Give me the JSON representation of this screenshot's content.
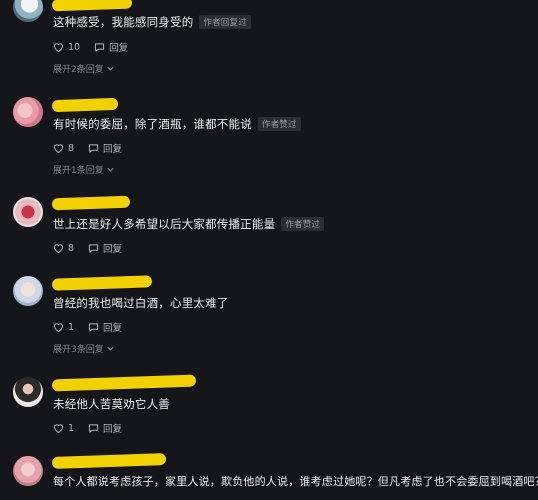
{
  "badge_label": "作者回复过",
  "badge_label_liked": "作者赞过",
  "reply_label": "回复",
  "comments": [
    {
      "text": "这种感受，我能感同身受的",
      "badge": "作者回复过",
      "likes": "10",
      "expand": "展开2条回复"
    },
    {
      "text": "有时候的委屈，除了酒瓶，谁都不能说",
      "badge": "作者赞过",
      "likes": "8",
      "expand": "展开1条回复"
    },
    {
      "text": "世上还是好人多希望以后大家都传播正能量",
      "badge": "作者赞过",
      "likes": "8"
    },
    {
      "text": "曾经的我也喝过白酒，心里太难了",
      "likes": "1",
      "expand": "展开3条回复"
    },
    {
      "text": "未经他人苦莫劝它人善",
      "likes": "1"
    },
    {
      "text": "每个人都说考虑孩子，家里人说，欺负他的人说，谁考虑过她呢？但凡考虑了也不会委屈到喝酒吧？"
    }
  ]
}
